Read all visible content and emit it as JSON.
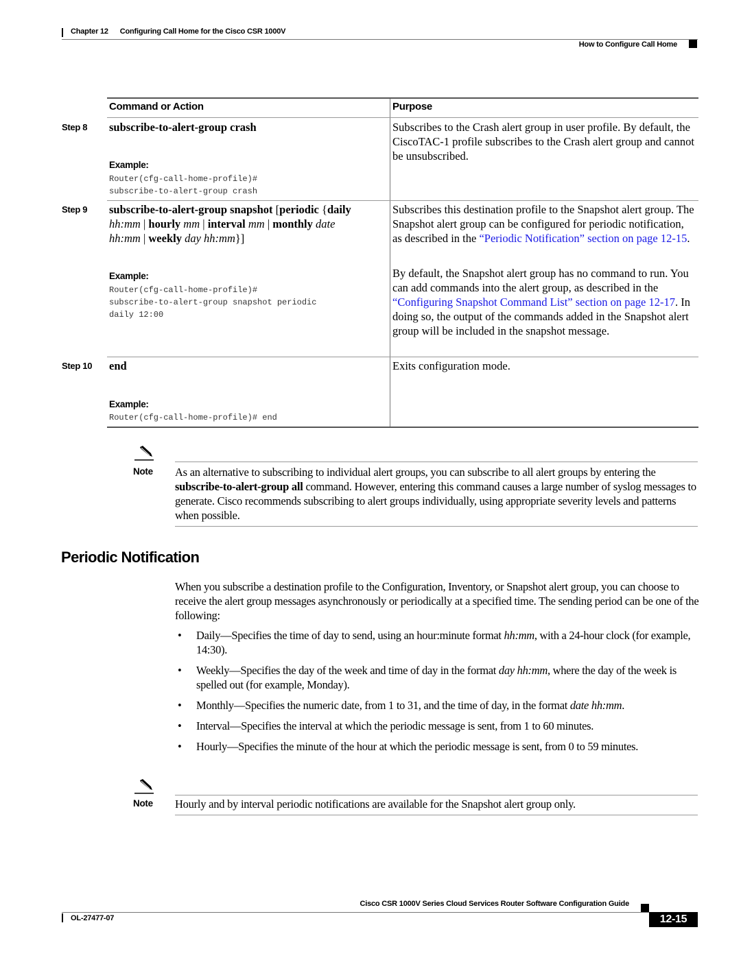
{
  "header": {
    "chapter_number": "Chapter 12",
    "chapter_title": "Configuring Call Home for the Cisco CSR 1000V",
    "section": "How to Configure Call Home"
  },
  "table": {
    "col_command": "Command or Action",
    "col_purpose": "Purpose",
    "example_label": "Example:",
    "rows": [
      {
        "step": "Step 8",
        "command": "subscribe-to-alert-group crash",
        "code_lines": [
          "Router(cfg-call-home-profile)#",
          "subscribe-to-alert-group crash"
        ],
        "purpose": "Subscribes to the Crash alert group in user profile. By default, the CiscoTAC-1 profile subscribes to the Crash alert group and cannot be unsubscribed."
      },
      {
        "step": "Step 9",
        "command_parts": {
          "p1": "subscribe-to-alert-group snapshot",
          "p2": " [",
          "p3": "periodic",
          "p4": " {",
          "p5": "daily",
          "p6": "hh:mm",
          "p7": " | ",
          "p8": "hourly",
          "p9": " mm",
          "p10": " | ",
          "p11": "interval",
          "p12": " mm",
          "p13": " | ",
          "p14": "monthly",
          "p15": " date",
          "p16": "hh:mm",
          "p17": " | ",
          "p18": "weekly",
          "p19": " day hh:mm",
          "p20": "}]"
        },
        "code_lines": [
          "Router(cfg-call-home-profile)#",
          "subscribe-to-alert-group snapshot periodic",
          "daily 12:00"
        ],
        "purpose_1_text": "Subscribes this destination profile to the Snapshot alert group. The Snapshot alert group can be configured for periodic notification, as described in the ",
        "purpose_1_link": "“Periodic Notification” section on page 12-15",
        "purpose_1_end": ".",
        "purpose_2_text": "By default, the Snapshot alert group has no command to run. You can add commands into the alert group, as described in the ",
        "purpose_2_link": "“Configuring Snapshot Command List” section on page 12-17",
        "purpose_2_end": ". In doing so, the output of the commands added in the Snapshot alert group will be included in the snapshot message."
      },
      {
        "step": "Step 10",
        "command": "end",
        "code_lines": [
          "Router(cfg-call-home-profile)# end"
        ],
        "purpose": "Exits configuration mode."
      }
    ]
  },
  "notes": [
    {
      "label": "Note",
      "text_1": "As an alternative to subscribing to individual alert groups, you can subscribe to all alert groups by entering the ",
      "bold": "subscribe-to-alert-group all",
      "text_2": " command. However, entering this command causes a large number of syslog messages to generate. Cisco recommends subscribing to alert groups individually, using appropriate severity levels and patterns when possible."
    },
    {
      "label": "Note",
      "text": "Hourly and by interval periodic notifications are available for the Snapshot alert group only."
    }
  ],
  "section": {
    "title": "Periodic Notification",
    "intro": "When you subscribe a destination profile to the Configuration, Inventory, or Snapshot alert group, you can choose to receive the alert group messages asynchronously or periodically at a specified time. The sending period can be one of the following:",
    "bullets": [
      {
        "a": "Daily—Specifies the time of day to send, using an hour:minute format ",
        "i": "hh:mm",
        "b": ", with a 24-hour clock (for example, 14:30)."
      },
      {
        "a": "Weekly—Specifies the day of the week and time of day in the format ",
        "i": "day hh:mm",
        "b": ", where the day of the week is spelled out (for example, Monday)."
      },
      {
        "a": "Monthly—Specifies the numeric date, from 1 to 31, and the time of day, in the format ",
        "i": "date hh:mm",
        "b": "."
      },
      {
        "a": "Interval—Specifies the interval at which the periodic message is sent, from 1 to 60 minutes.",
        "i": "",
        "b": ""
      },
      {
        "a": "Hourly—Specifies the minute of the hour at which the periodic message is sent, from 0 to 59 minutes.",
        "i": "",
        "b": ""
      }
    ],
    "bullet_glyph": "•"
  },
  "footer": {
    "guide_title": "Cisco CSR 1000V Series Cloud Services Router Software Configuration Guide",
    "doc_number": "OL-27477-07",
    "page_number": "12-15"
  },
  "colors": {
    "link": "#1a1ae6",
    "text": "#000000"
  }
}
